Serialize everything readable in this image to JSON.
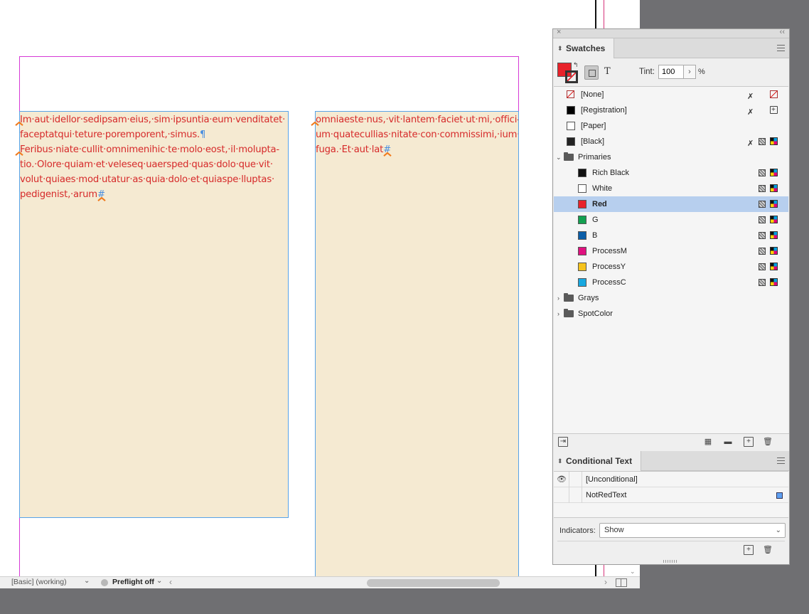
{
  "document": {
    "frame1_lines": [
      "Im·aut·idellor·sedipsam·eius,·sim·ipsuntia·eum·venditatet·",
      "faceptatqui·teture·poremporent,·simus.",
      "Feribus·niate·cullit·omnimenihic·te·molo·eost,·il·molupta-",
      "tio.·Olore·quiam·et·veleseq·uaersped·quas·dolo·que·vit·",
      "volut·quiaes·mod·utatur·as·quia·dolo·et·quiaspe·lluptas·",
      "pedigenist,·arum"
    ],
    "frame1_pilcrow": "¶",
    "frame1_end": "#",
    "frame2_lines": [
      "omniaeste·nus,·vit·lantem·faciet·ut·mi,·offici-",
      "um·quatecullias·nitate·con·commissimi,·ium·",
      "fuga.·Et·aut·lat"
    ],
    "frame2_end": "#"
  },
  "statusbar": {
    "profile": "[Basic] (working)",
    "preflight": "Preflight off"
  },
  "swatches_panel": {
    "tab_label": "Swatches",
    "tint_label": "Tint:",
    "tint_value": "100",
    "tint_unit": "%",
    "text_toggle": "T",
    "fill_color": "#e8222a",
    "items": [
      {
        "label": "[None]"
      },
      {
        "label": "[Registration]"
      },
      {
        "label": "[Paper]"
      },
      {
        "label": "[Black]"
      },
      {
        "label": "Primaries"
      },
      {
        "label": "Rich Black",
        "color": "#111111"
      },
      {
        "label": "White",
        "color": "#ffffff"
      },
      {
        "label": "Red",
        "color": "#e8222a",
        "selected": true
      },
      {
        "label": "G",
        "color": "#12a050"
      },
      {
        "label": "B",
        "color": "#0b5ea8"
      },
      {
        "label": "ProcessM",
        "color": "#e0117f"
      },
      {
        "label": "ProcessY",
        "color": "#f6c31c"
      },
      {
        "label": "ProcessC",
        "color": "#18a8e0"
      },
      {
        "label": "Grays"
      },
      {
        "label": "SpotColor"
      }
    ]
  },
  "conditional_panel": {
    "tab_label": "Conditional Text",
    "conditions": [
      {
        "label": "[Unconditional]"
      },
      {
        "label": "NotRedText",
        "color": "#5ea0f2"
      }
    ],
    "indicators_label": "Indicators:",
    "indicators_value": "Show"
  }
}
